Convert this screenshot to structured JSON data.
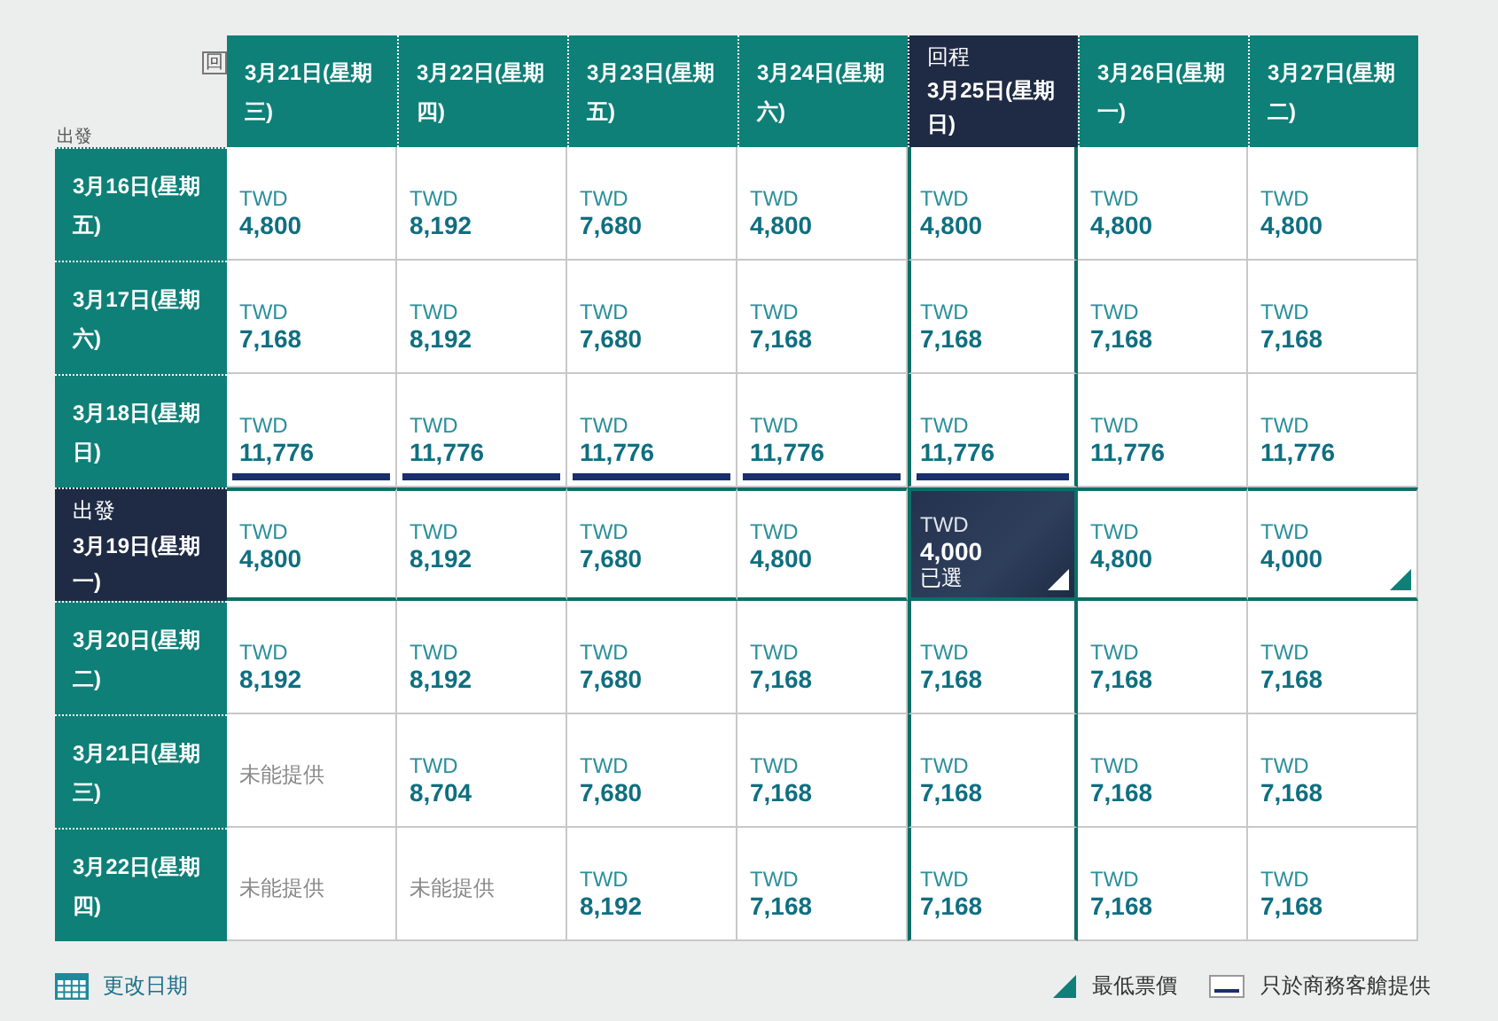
{
  "corner": {
    "return_label": "回",
    "depart_label": "出發"
  },
  "columns": [
    {
      "label": "3月21日(星期三)",
      "selected": false
    },
    {
      "label": "3月22日(星期四)",
      "selected": false
    },
    {
      "label": "3月23日(星期五)",
      "selected": false
    },
    {
      "label": "3月24日(星期六)",
      "selected": false
    },
    {
      "label": "3月25日(星期日)",
      "selected": true,
      "prefix": "回程"
    },
    {
      "label": "3月26日(星期一)",
      "selected": false
    },
    {
      "label": "3月27日(星期二)",
      "selected": false
    }
  ],
  "rows": [
    {
      "label": "3月16日(星期五)",
      "selected": false,
      "cells": [
        {
          "kind": "price",
          "currency": "TWD",
          "amount": "4,800",
          "selected": false,
          "lowest": false,
          "business_only": false
        },
        {
          "kind": "price",
          "currency": "TWD",
          "amount": "8,192",
          "selected": false,
          "lowest": false,
          "business_only": false
        },
        {
          "kind": "price",
          "currency": "TWD",
          "amount": "7,680",
          "selected": false,
          "lowest": false,
          "business_only": false
        },
        {
          "kind": "price",
          "currency": "TWD",
          "amount": "4,800",
          "selected": false,
          "lowest": false,
          "business_only": false
        },
        {
          "kind": "price",
          "currency": "TWD",
          "amount": "4,800",
          "selected": false,
          "lowest": false,
          "business_only": false
        },
        {
          "kind": "price",
          "currency": "TWD",
          "amount": "4,800",
          "selected": false,
          "lowest": false,
          "business_only": false
        },
        {
          "kind": "price",
          "currency": "TWD",
          "amount": "4,800",
          "selected": false,
          "lowest": false,
          "business_only": false
        }
      ]
    },
    {
      "label": "3月17日(星期六)",
      "selected": false,
      "cells": [
        {
          "kind": "price",
          "currency": "TWD",
          "amount": "7,168",
          "selected": false,
          "lowest": false,
          "business_only": false
        },
        {
          "kind": "price",
          "currency": "TWD",
          "amount": "8,192",
          "selected": false,
          "lowest": false,
          "business_only": false
        },
        {
          "kind": "price",
          "currency": "TWD",
          "amount": "7,680",
          "selected": false,
          "lowest": false,
          "business_only": false
        },
        {
          "kind": "price",
          "currency": "TWD",
          "amount": "7,168",
          "selected": false,
          "lowest": false,
          "business_only": false
        },
        {
          "kind": "price",
          "currency": "TWD",
          "amount": "7,168",
          "selected": false,
          "lowest": false,
          "business_only": false
        },
        {
          "kind": "price",
          "currency": "TWD",
          "amount": "7,168",
          "selected": false,
          "lowest": false,
          "business_only": false
        },
        {
          "kind": "price",
          "currency": "TWD",
          "amount": "7,168",
          "selected": false,
          "lowest": false,
          "business_only": false
        }
      ]
    },
    {
      "label": "3月18日(星期日)",
      "selected": false,
      "cells": [
        {
          "kind": "price",
          "currency": "TWD",
          "amount": "11,776",
          "selected": false,
          "lowest": false,
          "business_only": true
        },
        {
          "kind": "price",
          "currency": "TWD",
          "amount": "11,776",
          "selected": false,
          "lowest": false,
          "business_only": true
        },
        {
          "kind": "price",
          "currency": "TWD",
          "amount": "11,776",
          "selected": false,
          "lowest": false,
          "business_only": true
        },
        {
          "kind": "price",
          "currency": "TWD",
          "amount": "11,776",
          "selected": false,
          "lowest": false,
          "business_only": true
        },
        {
          "kind": "price",
          "currency": "TWD",
          "amount": "11,776",
          "selected": false,
          "lowest": false,
          "business_only": true
        },
        {
          "kind": "price",
          "currency": "TWD",
          "amount": "11,776",
          "selected": false,
          "lowest": false,
          "business_only": false
        },
        {
          "kind": "price",
          "currency": "TWD",
          "amount": "11,776",
          "selected": false,
          "lowest": false,
          "business_only": false
        }
      ]
    },
    {
      "label": "3月19日(星期一)",
      "selected": true,
      "prefix": "出發",
      "cells": [
        {
          "kind": "price",
          "currency": "TWD",
          "amount": "4,800",
          "selected": false,
          "lowest": false,
          "business_only": false
        },
        {
          "kind": "price",
          "currency": "TWD",
          "amount": "8,192",
          "selected": false,
          "lowest": false,
          "business_only": false
        },
        {
          "kind": "price",
          "currency": "TWD",
          "amount": "7,680",
          "selected": false,
          "lowest": false,
          "business_only": false
        },
        {
          "kind": "price",
          "currency": "TWD",
          "amount": "4,800",
          "selected": false,
          "lowest": false,
          "business_only": false
        },
        {
          "kind": "price",
          "currency": "TWD",
          "amount": "4,000",
          "selected": true,
          "status": "已選",
          "lowest": true,
          "business_only": false
        },
        {
          "kind": "price",
          "currency": "TWD",
          "amount": "4,800",
          "selected": false,
          "lowest": false,
          "business_only": false
        },
        {
          "kind": "price",
          "currency": "TWD",
          "amount": "4,000",
          "selected": false,
          "lowest": true,
          "business_only": false
        }
      ]
    },
    {
      "label": "3月20日(星期二)",
      "selected": false,
      "cells": [
        {
          "kind": "price",
          "currency": "TWD",
          "amount": "8,192",
          "selected": false,
          "lowest": false,
          "business_only": false
        },
        {
          "kind": "price",
          "currency": "TWD",
          "amount": "8,192",
          "selected": false,
          "lowest": false,
          "business_only": false
        },
        {
          "kind": "price",
          "currency": "TWD",
          "amount": "7,680",
          "selected": false,
          "lowest": false,
          "business_only": false
        },
        {
          "kind": "price",
          "currency": "TWD",
          "amount": "7,168",
          "selected": false,
          "lowest": false,
          "business_only": false
        },
        {
          "kind": "price",
          "currency": "TWD",
          "amount": "7,168",
          "selected": false,
          "lowest": false,
          "business_only": false
        },
        {
          "kind": "price",
          "currency": "TWD",
          "amount": "7,168",
          "selected": false,
          "lowest": false,
          "business_only": false
        },
        {
          "kind": "price",
          "currency": "TWD",
          "amount": "7,168",
          "selected": false,
          "lowest": false,
          "business_only": false
        }
      ]
    },
    {
      "label": "3月21日(星期三)",
      "selected": false,
      "cells": [
        {
          "kind": "unavailable",
          "text": "未能提供"
        },
        {
          "kind": "price",
          "currency": "TWD",
          "amount": "8,704",
          "selected": false,
          "lowest": false,
          "business_only": false
        },
        {
          "kind": "price",
          "currency": "TWD",
          "amount": "7,680",
          "selected": false,
          "lowest": false,
          "business_only": false
        },
        {
          "kind": "price",
          "currency": "TWD",
          "amount": "7,168",
          "selected": false,
          "lowest": false,
          "business_only": false
        },
        {
          "kind": "price",
          "currency": "TWD",
          "amount": "7,168",
          "selected": false,
          "lowest": false,
          "business_only": false
        },
        {
          "kind": "price",
          "currency": "TWD",
          "amount": "7,168",
          "selected": false,
          "lowest": false,
          "business_only": false
        },
        {
          "kind": "price",
          "currency": "TWD",
          "amount": "7,168",
          "selected": false,
          "lowest": false,
          "business_only": false
        }
      ]
    },
    {
      "label": "3月22日(星期四)",
      "selected": false,
      "cells": [
        {
          "kind": "unavailable",
          "text": "未能提供"
        },
        {
          "kind": "unavailable",
          "text": "未能提供"
        },
        {
          "kind": "price",
          "currency": "TWD",
          "amount": "8,192",
          "selected": false,
          "lowest": false,
          "business_only": false
        },
        {
          "kind": "price",
          "currency": "TWD",
          "amount": "7,168",
          "selected": false,
          "lowest": false,
          "business_only": false
        },
        {
          "kind": "price",
          "currency": "TWD",
          "amount": "7,168",
          "selected": false,
          "lowest": false,
          "business_only": false
        },
        {
          "kind": "price",
          "currency": "TWD",
          "amount": "7,168",
          "selected": false,
          "lowest": false,
          "business_only": false
        },
        {
          "kind": "price",
          "currency": "TWD",
          "amount": "7,168",
          "selected": false,
          "lowest": false,
          "business_only": false
        }
      ]
    }
  ],
  "footer": {
    "change_dates": "更改日期",
    "legend": [
      {
        "kind": "lowest",
        "label": "最低票價"
      },
      {
        "kind": "business",
        "label": "只於商務客艙提供"
      }
    ]
  }
}
